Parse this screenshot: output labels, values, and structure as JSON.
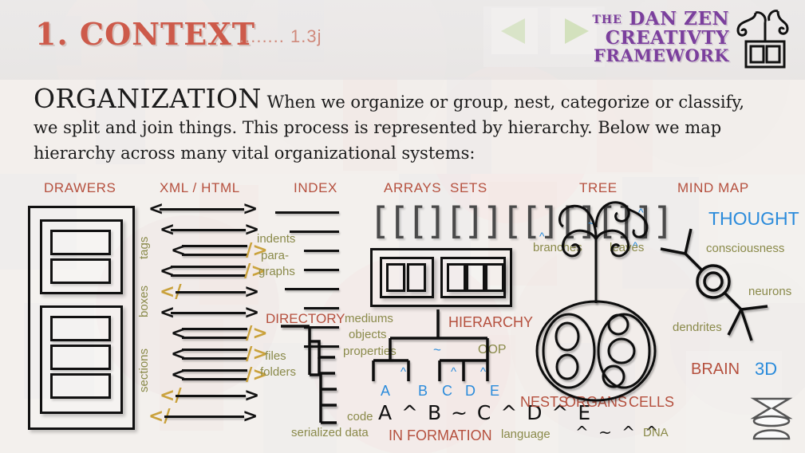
{
  "header": {
    "slide_number_title": "1. CONTEXT",
    "version": "........ 1.3j",
    "nav_prev_icon": "triangle-left-icon",
    "nav_next_icon": "triangle-right-icon",
    "logo": {
      "the": "THE",
      "line1": "DAN ZEN",
      "line2": "CREATIVTY",
      "line3": "FRAMEWORK",
      "mark_icon": "dan-zen-mark-icon"
    },
    "colors": {
      "title": "#cd5a4a",
      "logo": "#7b3f9d",
      "heading": "#b5503e",
      "label_olive": "#8a8a4a",
      "label_blue": "#2a8bdb",
      "nav_arrow": "#d6e3c2"
    }
  },
  "intro": {
    "lead": "ORGANIZATION",
    "body": " When we organize or group, nest, categorize or classify, we split and join things.  This process is represented by hierarchy.  Below we map hierarchy  across many vital organizational systems:"
  },
  "columns": {
    "drawers": {
      "heading": "DRAWERS"
    },
    "xml": {
      "heading": "XML / HTML",
      "vertical_labels": [
        "tags",
        "boxes",
        "sections"
      ],
      "rows": [
        {
          "open": "<",
          "close": ">",
          "indent": 0,
          "bars": 1
        },
        {
          "open": "<",
          "close": ">",
          "indent": 1,
          "bars": 1
        },
        {
          "open": "<",
          "close": "/>",
          "indent": 2,
          "bars": 2
        },
        {
          "open": "<",
          "close": "/>",
          "indent": 1,
          "bars": 2
        },
        {
          "open": "</",
          "close": ">",
          "indent": 1,
          "bars": 1
        },
        {
          "open": "<",
          "close": ">",
          "indent": 1,
          "bars": 1
        },
        {
          "open": "<",
          "close": "/>",
          "indent": 2,
          "bars": 2
        },
        {
          "open": "<",
          "close": "/>",
          "indent": 2,
          "bars": 2
        },
        {
          "open": "<",
          "close": "/>",
          "indent": 2,
          "bars": 2
        },
        {
          "open": "</",
          "close": ">",
          "indent": 1,
          "bars": 1
        },
        {
          "open": "</",
          "close": ">",
          "indent": 0,
          "bars": 1
        }
      ]
    },
    "index": {
      "heading": "INDEX",
      "labels": [
        "indents",
        "para-",
        "graphs"
      ],
      "line_indents": [
        0,
        18,
        36,
        36,
        12,
        36,
        36,
        36
      ],
      "directory": {
        "heading": "DIRECTORY",
        "labels": [
          "files",
          "folders"
        ]
      },
      "code_labels": [
        "code",
        "serialized data"
      ]
    },
    "arrays": {
      "heading": "ARRAYS",
      "notation": "[[[][]][[][][]]]"
    },
    "sets": {
      "heading": "SETS",
      "labels": [
        "mediums",
        "objects",
        "properties"
      ]
    },
    "hierarchy": {
      "heading": "HIERARCHY",
      "oop_label": "OOP",
      "leaves": [
        "A",
        "B",
        "C",
        "D",
        "E"
      ],
      "operators": {
        "join": "~",
        "split": "^"
      },
      "formula": "A ^ B ~ C ^ D ^ E",
      "footer": "IN FORMATION"
    },
    "tree": {
      "heading": "TREE",
      "labels": [
        "branches",
        "leaves"
      ],
      "operator_marks": [
        "^",
        "~",
        "^",
        "^"
      ]
    },
    "biology": {
      "heading_words": [
        "NESTS",
        "ORGANS",
        "CELLS"
      ],
      "formula": "^ ~ ^ ^",
      "language_label": "language",
      "dna_label": "DNA"
    },
    "mindmap": {
      "heading": "MIND MAP",
      "thought": "THOUGHT",
      "consciousness": "consciousness",
      "neurons": "neurons",
      "dendrites": "dendrites",
      "brain": "BRAIN",
      "three_d": "3D",
      "mark_icon": "dan-zen-mark-icon"
    }
  }
}
